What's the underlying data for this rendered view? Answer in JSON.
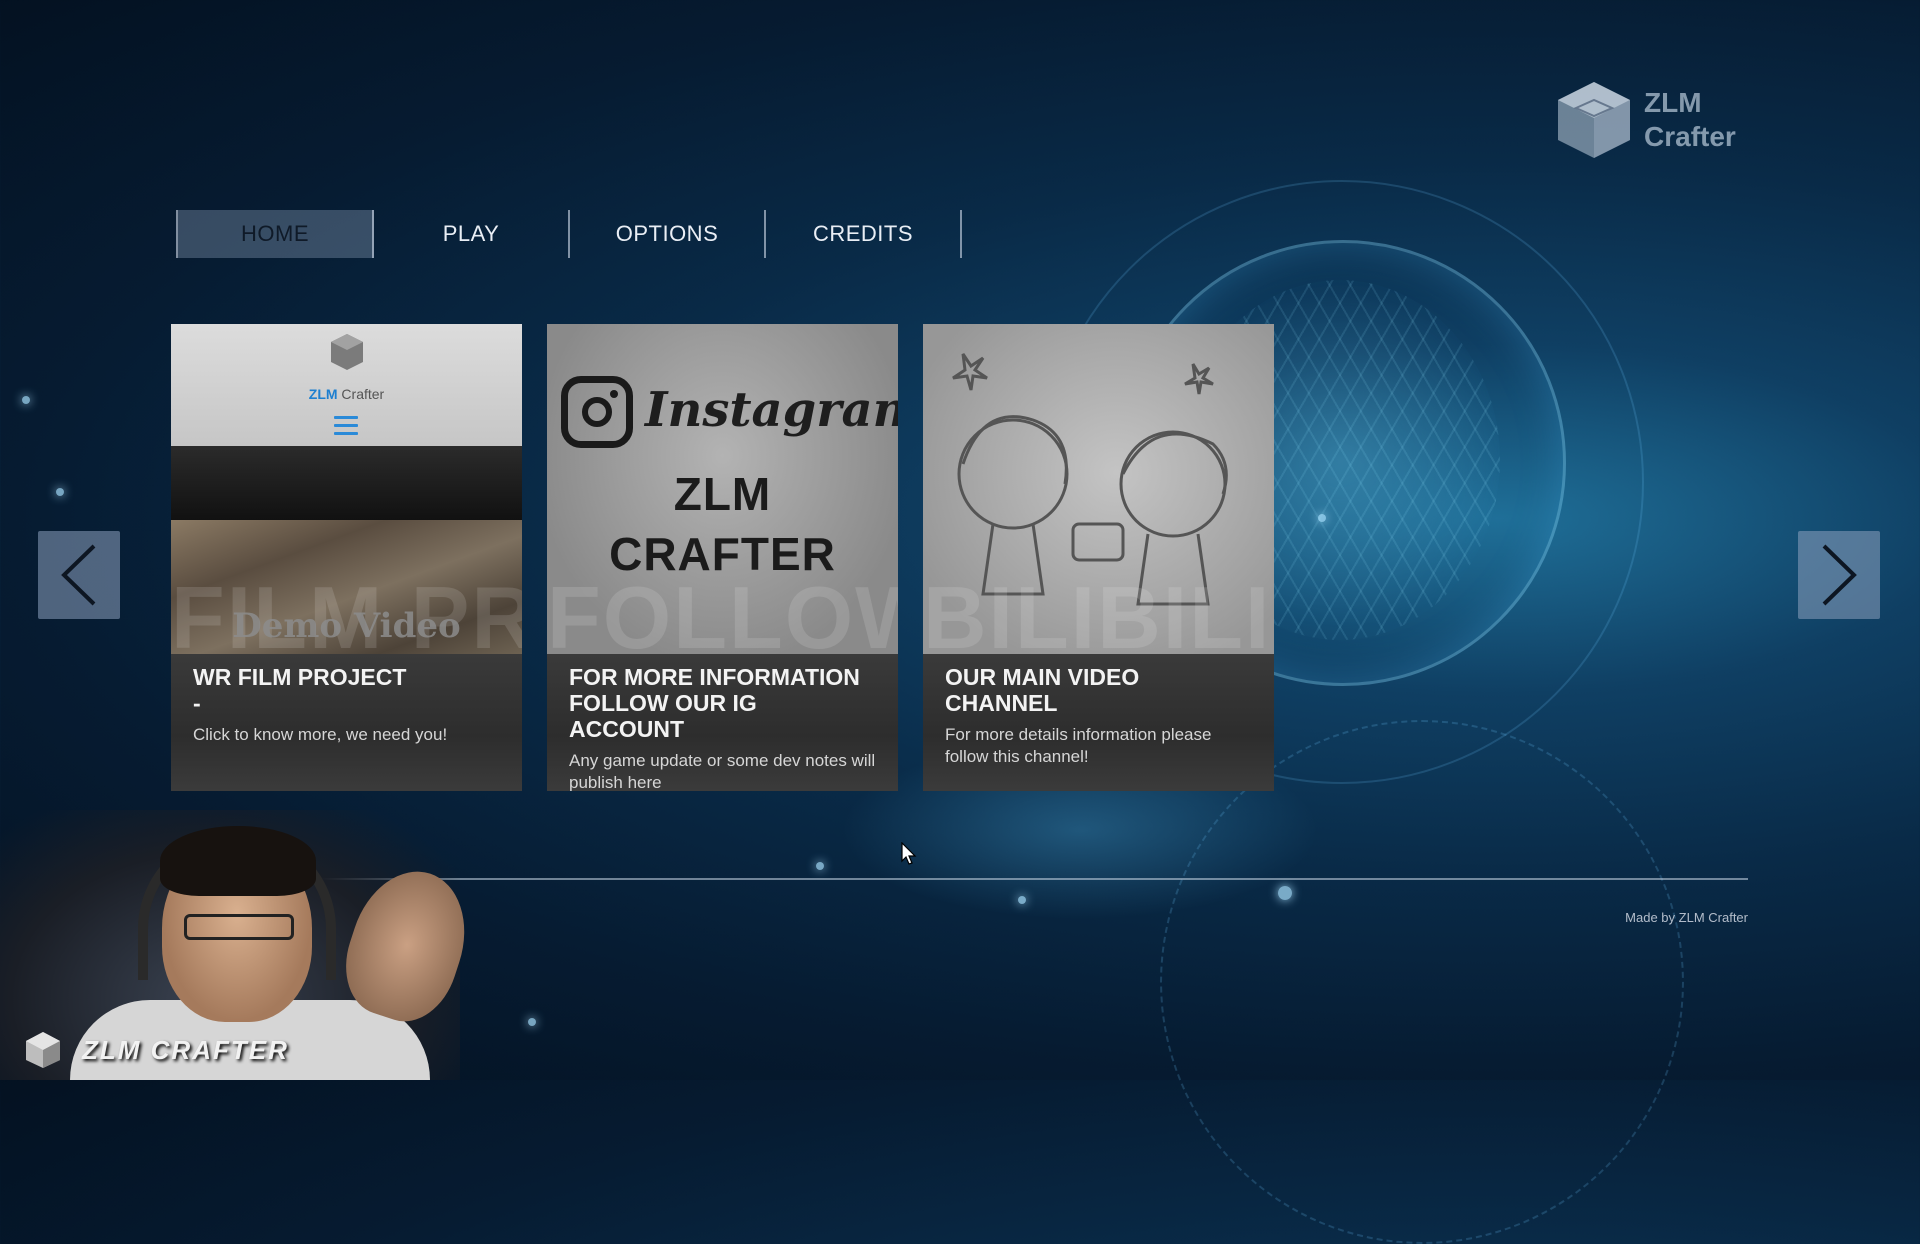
{
  "brand": {
    "line1": "ZLM",
    "line2": "Crafter"
  },
  "nav": {
    "items": [
      {
        "label": "HOME",
        "active": true
      },
      {
        "label": "PLAY",
        "active": false
      },
      {
        "label": "OPTIONS",
        "active": false
      },
      {
        "label": "CREDITS",
        "active": false
      }
    ]
  },
  "cards": [
    {
      "title": "WR FILM PROJECT\n-",
      "description": "Click to know more, we need you!",
      "bigword": "FILM PR",
      "image": {
        "site_brand_bold": "ZLM",
        "site_brand": "Crafter",
        "caption": "Demo Video"
      }
    },
    {
      "title": "FOR MORE INFORMATION FOLLOW OUR IG ACCOUNT",
      "description": "Any game update or some dev notes will publish here",
      "bigword": "FOLLOW",
      "image": {
        "platform": "Instagram",
        "name_line1": "ZLM",
        "name_line2": "CRAFTER"
      }
    },
    {
      "title": "OUR MAIN VIDEO CHANNEL",
      "description": "For more details information please follow this channel!",
      "bigword": "BILIBILI",
      "image": {}
    }
  ],
  "footer": {
    "made_by": "Made by ZLM Crafter"
  },
  "webcam": {
    "watermark": "ZLM CRAFTER"
  },
  "icons": {
    "prev": "chevron-left-icon",
    "next": "chevron-right-icon",
    "logo": "cube-logo-icon"
  },
  "colors": {
    "accent": "#1d7fd0",
    "card_info_bg": "#2d2d2d",
    "nav_active_bg": "#8f9fb5"
  }
}
